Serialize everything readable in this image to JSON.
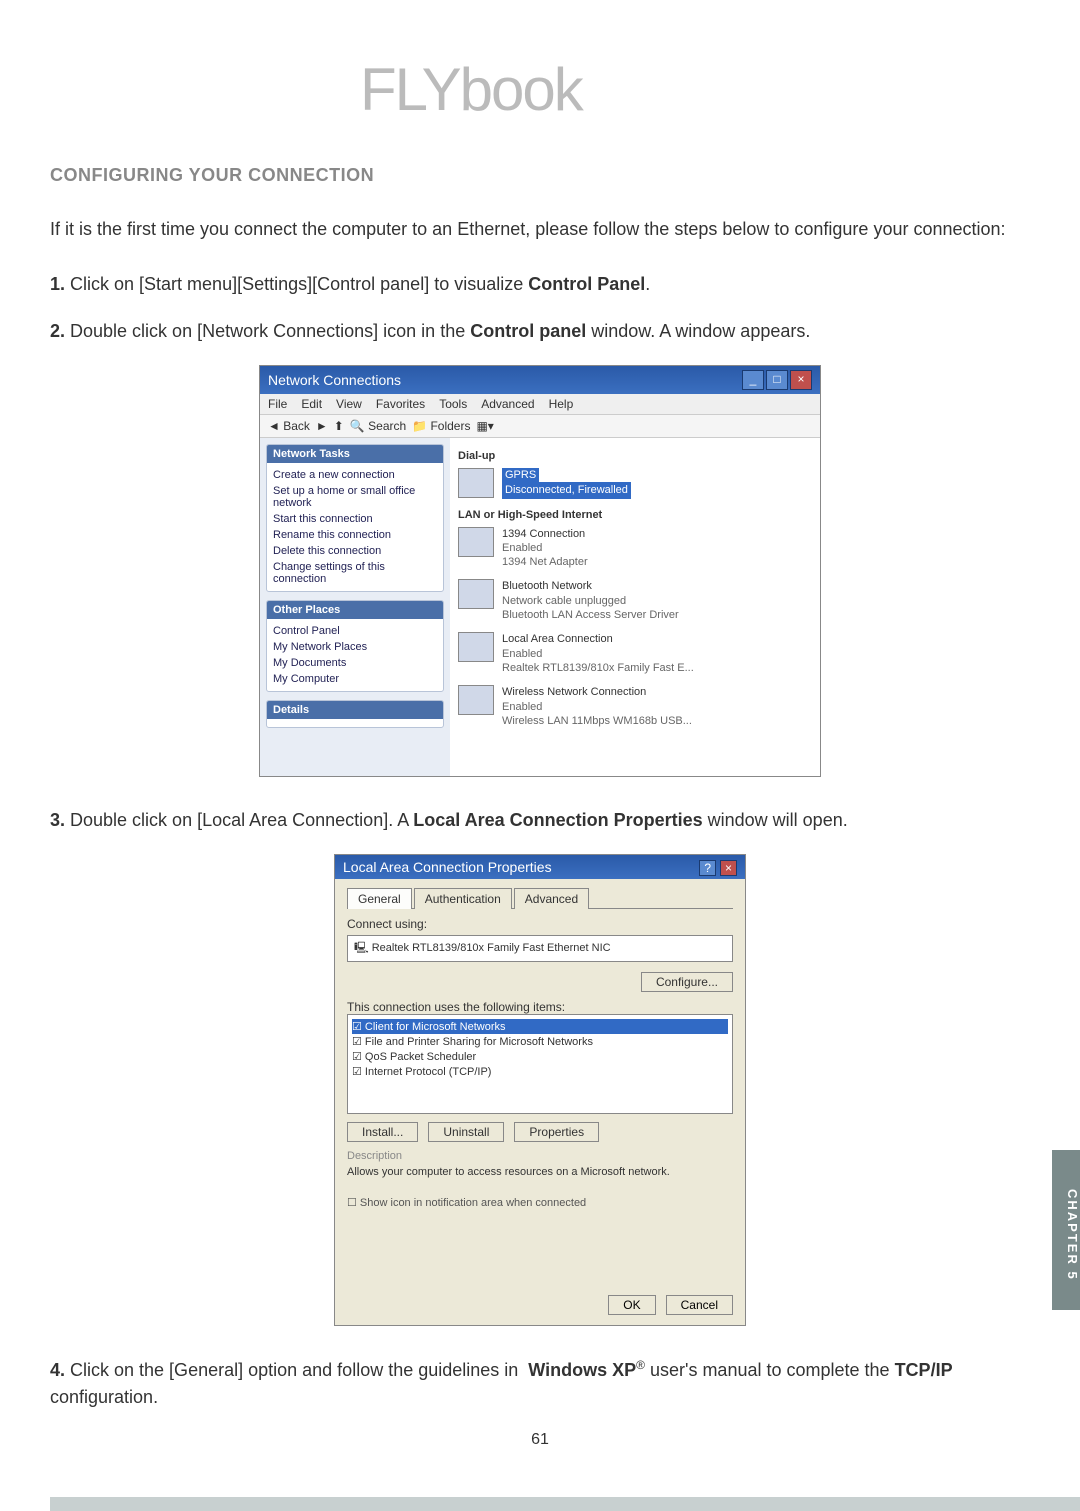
{
  "logo_text": "FLYbook",
  "section_title": "CONFIGURING YOUR CONNECTION",
  "intro": "If it is the first time you connect the computer to an Ethernet, please follow the steps below to configure your connection:",
  "steps": {
    "s1_num": "1.",
    "s1_a": " Click on [Start menu][Settings][Control panel] to visualize ",
    "s1_b": "Control Panel",
    "s1_c": ".",
    "s2_num": "2.",
    "s2_a": " Double click on [Network Connections] icon in the ",
    "s2_b": "Control panel",
    "s2_c": " window. A window appears.",
    "s3_num": "3.",
    "s3_a": " Double click on [Local Area Connection]. A ",
    "s3_b": "Local Area Connection Properties",
    "s3_c": " window will open.",
    "s4_num": "4.",
    "s4_a": " Click on the [General] option and follow the guidelines in  ",
    "s4_b": "Windows XP",
    "s4_sup": "®",
    "s4_c": " user's manual to complete the ",
    "s4_d": "TCP/IP",
    "s4_e": " configuration."
  },
  "nc": {
    "title": "Network Connections",
    "menu": [
      "File",
      "Edit",
      "View",
      "Favorites",
      "Tools",
      "Advanced",
      "Help"
    ],
    "toolbar_back": "Back",
    "toolbar_search": "Search",
    "toolbar_folders": "Folders",
    "side_tasks_h": "Network Tasks",
    "side_tasks": [
      "Create a new connection",
      "Set up a home or small office network",
      "Start this connection",
      "Rename this connection",
      "Delete this connection",
      "Change settings of this connection"
    ],
    "side_other_h": "Other Places",
    "side_other": [
      "Control Panel",
      "My Network Places",
      "My Documents",
      "My Computer"
    ],
    "side_details_h": "Details",
    "grp_dialup": "Dial-up",
    "conn_gprs_name": "GPRS",
    "conn_gprs_sub": "Disconnected, Firewalled",
    "grp_lan": "LAN or High-Speed Internet",
    "conn_1394_name": "1394 Connection",
    "conn_1394_sub1": "Enabled",
    "conn_1394_sub2": "1394 Net Adapter",
    "conn_bt_name": "Bluetooth Network",
    "conn_bt_sub1": "Network cable unplugged",
    "conn_bt_sub2": "Bluetooth LAN Access Server Driver",
    "conn_lac_name": "Local Area Connection",
    "conn_lac_sub1": "Enabled",
    "conn_lac_sub2": "Realtek RTL8139/810x Family Fast E...",
    "conn_wlan_name": "Wireless Network Connection",
    "conn_wlan_sub1": "Enabled",
    "conn_wlan_sub2": "Wireless LAN 11Mbps WM168b USB..."
  },
  "lacp": {
    "title": "Local Area Connection Properties",
    "tabs": [
      "General",
      "Authentication",
      "Advanced"
    ],
    "connect_using": "Connect using:",
    "adapter": "Realtek RTL8139/810x Family Fast Ethernet NIC",
    "configure": "Configure...",
    "items_label": "This connection uses the following items:",
    "items": [
      "Client for Microsoft Networks",
      "File and Printer Sharing for Microsoft Networks",
      "QoS Packet Scheduler",
      "Internet Protocol (TCP/IP)"
    ],
    "install": "Install...",
    "uninstall": "Uninstall",
    "properties": "Properties",
    "desc_h": "Description",
    "desc": "Allows your computer to access resources on a Microsoft network.",
    "showicon": "Show icon in notification area when connected",
    "ok": "OK",
    "cancel": "Cancel"
  },
  "chapter_tab": "CHAPTER 5",
  "page_number": "61"
}
